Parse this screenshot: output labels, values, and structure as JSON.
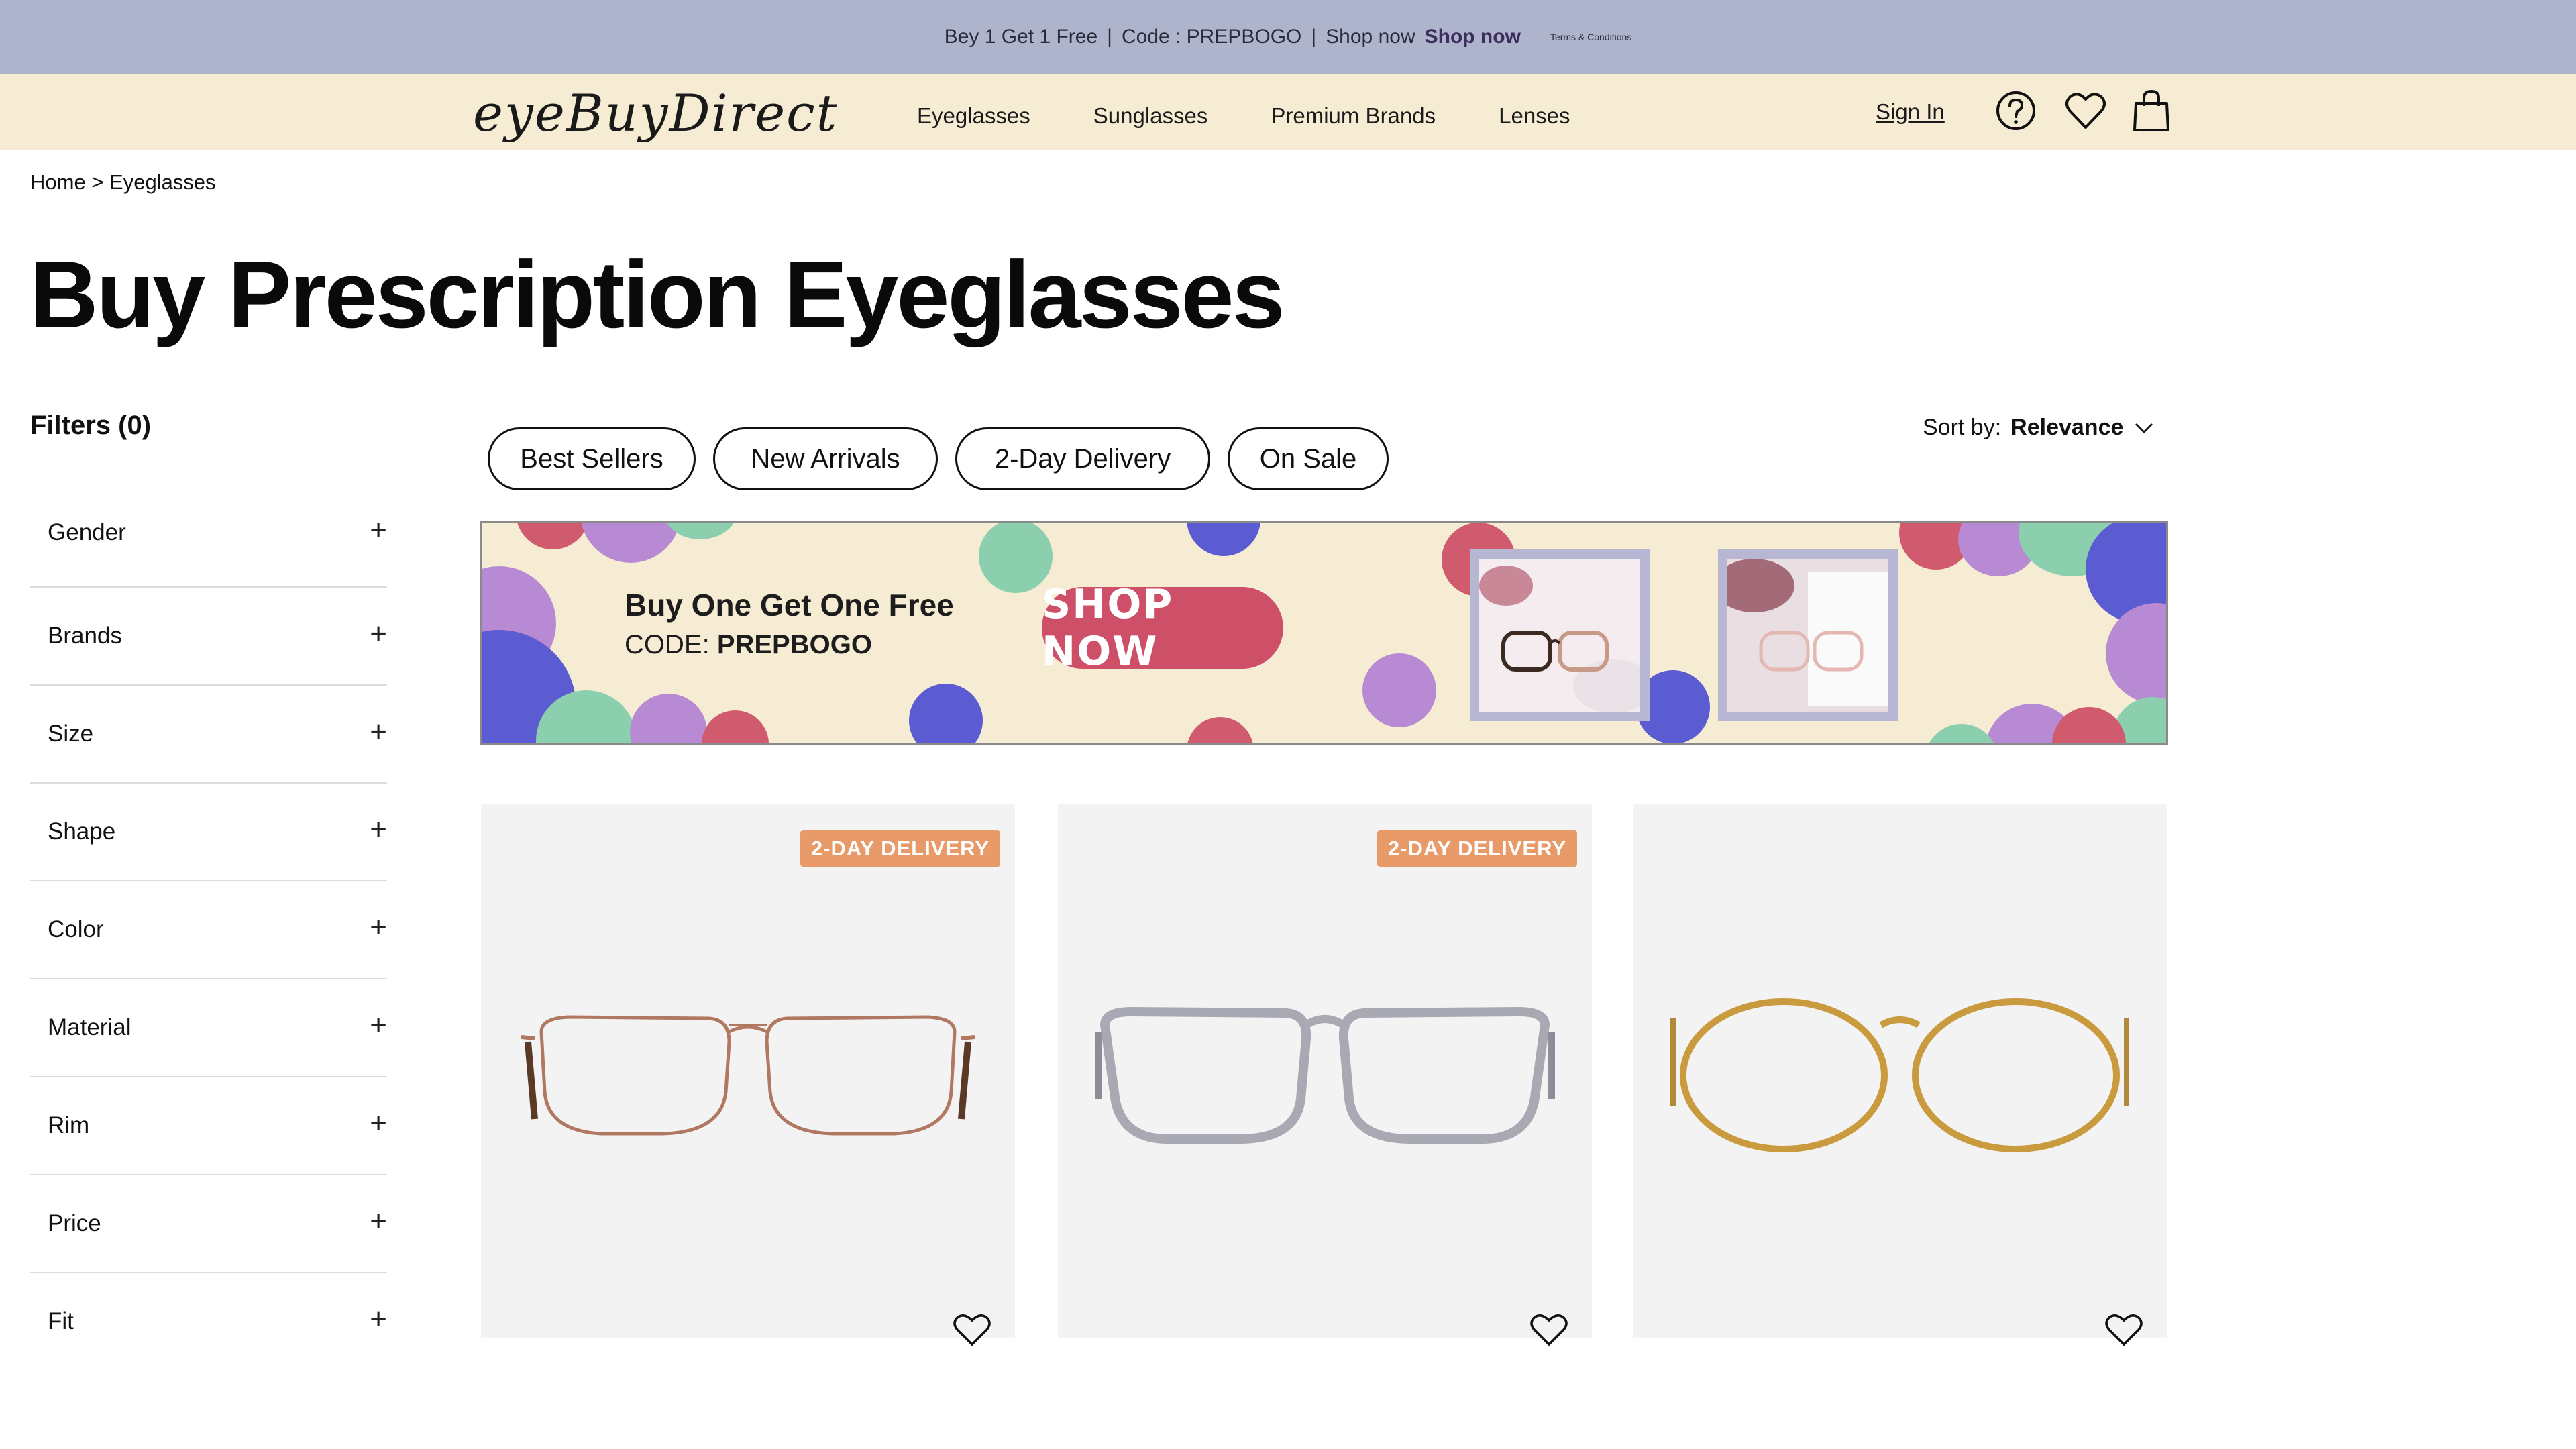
{
  "promo": {
    "part1": "Bey 1 Get 1 Free",
    "sep": "|",
    "part2": "Code : PREPBOGO",
    "part3": "Shop now",
    "part4": "Shop now",
    "terms": "Terms & Conditions"
  },
  "header": {
    "logo": "eyeBuyDirect",
    "nav": [
      "Eyeglasses",
      "Sunglasses",
      "Premium Brands",
      "Lenses"
    ],
    "sign_in": "Sign In",
    "icons": [
      "help-icon",
      "heart-icon",
      "shopping-bag-icon"
    ]
  },
  "breadcrumb": "Home > Eyeglasses",
  "page_title": "Buy Prescription Eyeglasses",
  "filters": {
    "title": "Filters (0)",
    "items": [
      "Gender",
      "Brands",
      "Size",
      "Shape",
      "Color",
      "Material",
      "Rim",
      "Price",
      "Fit"
    ],
    "expand_symbol": "+"
  },
  "quick_filters": [
    "Best Sellers",
    "New Arrivals",
    "2-Day Delivery",
    "On Sale"
  ],
  "sort": {
    "label": "Sort by:",
    "value": "Relevance"
  },
  "banner": {
    "headline": "Buy One Get One Free",
    "code_label": "CODE:",
    "code": "PREPBOGO",
    "button": "SHOP NOW"
  },
  "products": [
    {
      "badge": "2-DAY DELIVERY",
      "frame_color": "#b07860"
    },
    {
      "badge": "2-DAY DELIVERY",
      "frame_color": "#a9a9b3"
    },
    {
      "badge": "",
      "frame_color": "#c99a3e"
    }
  ],
  "colors": {
    "promo_bg": "#adb4cb",
    "header_bg": "#f6ecd3",
    "banner_button": "#cd5068",
    "badge": "#e89b69",
    "dot_pink": "#d05a6e",
    "dot_purple": "#b88ad4",
    "dot_green": "#8ccfae",
    "dot_blue": "#5b5bd2"
  }
}
